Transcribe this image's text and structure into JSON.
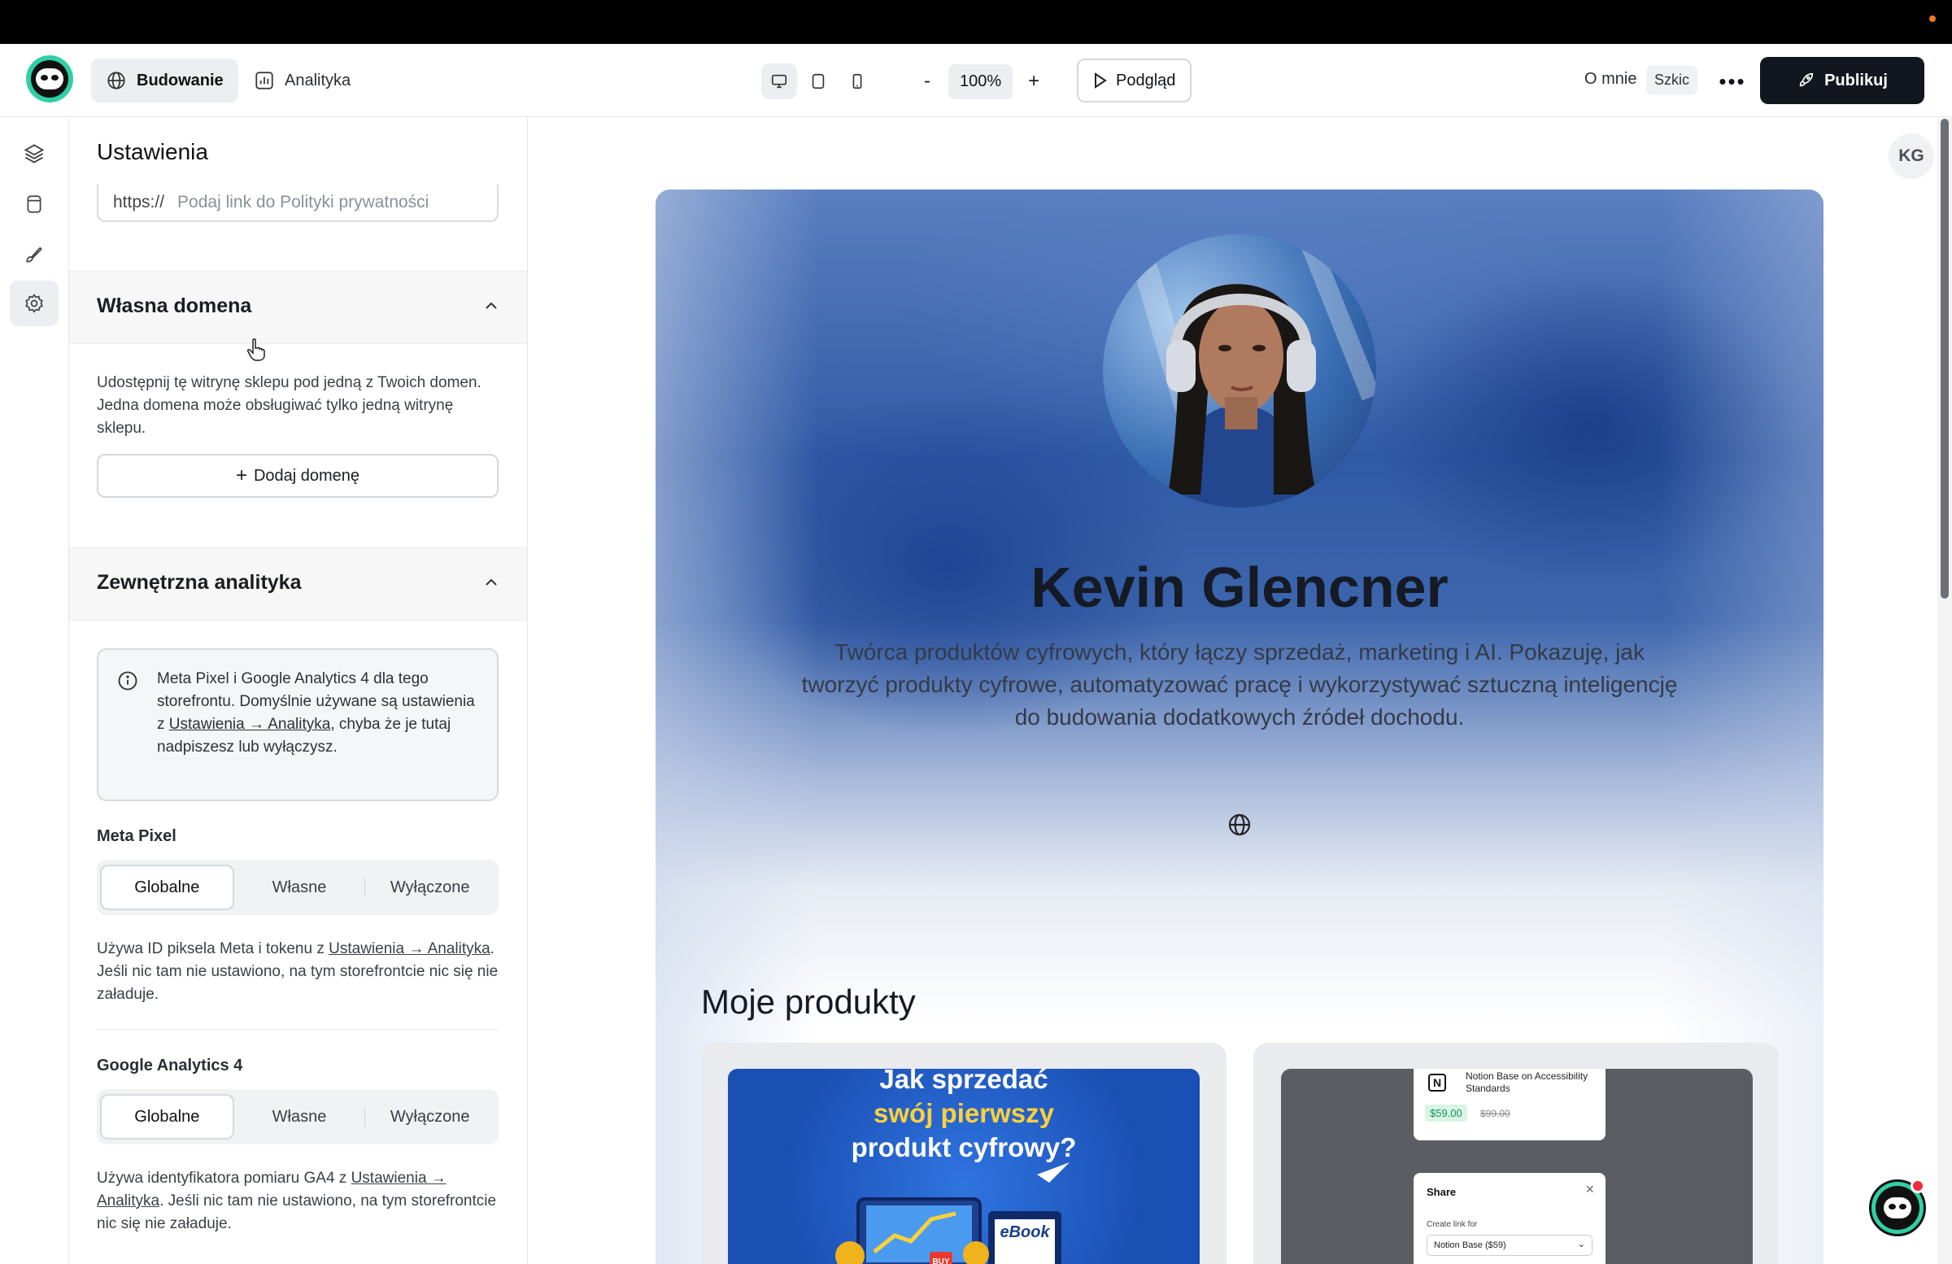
{
  "header": {
    "tabs": [
      {
        "label": "Budowanie",
        "icon": "globe-icon",
        "active": true
      },
      {
        "label": "Analityka",
        "icon": "bar-chart-icon",
        "active": false
      }
    ],
    "zoom": {
      "minus": "-",
      "value": "100%",
      "plus": "+"
    },
    "preview_label": "Podgląd",
    "page_name": "O mnie",
    "status_badge": "Szkic",
    "more_label": "•••",
    "publish_label": "Publikuj"
  },
  "rail": {
    "items": [
      {
        "icon": "layers-icon",
        "active": false
      },
      {
        "icon": "database-icon",
        "active": false
      },
      {
        "icon": "brush-icon",
        "active": false
      },
      {
        "icon": "gear-icon",
        "active": true
      }
    ]
  },
  "settings": {
    "title": "Ustawienia",
    "privacy_field": {
      "prefix": "https://",
      "placeholder": "Podaj link do Polityki prywatności"
    },
    "custom_domain": {
      "title": "Własna domena",
      "description": "Udostępnij tę witrynę sklepu pod jedną z Twoich domen. Jedna domena może obsługiwać tylko jedną witrynę sklepu.",
      "add_button": "Dodaj domenę"
    },
    "external_analytics": {
      "title": "Zewnętrzna analityka",
      "info_before": "Meta Pixel i Google Analytics 4 dla tego storefrontu. Domyślnie używane są ustawienia z ",
      "info_link": "Ustawienia → Analityka",
      "info_after": ", chyba że je tutaj nadpiszesz lub wyłączysz.",
      "meta_pixel": {
        "label": "Meta Pixel",
        "options": [
          "Globalne",
          "Własne",
          "Wyłączone"
        ],
        "selected": "Globalne",
        "help_before": "Używa ID piksela Meta i tokenu z ",
        "help_link": "Ustawienia → Analityka",
        "help_after": ". Jeśli nic tam nie ustawiono, na tym storefrontcie nic się nie załaduje."
      },
      "ga4": {
        "label": "Google Analytics 4",
        "options": [
          "Globalne",
          "Własne",
          "Wyłączone"
        ],
        "selected": "Globalne",
        "help_before": "Używa identyfikatora pomiaru GA4 z ",
        "help_link": "Ustawienia → Analityka",
        "help_after": ". Jeśli nic tam nie ustawiono, na tym storefrontcie nic się nie załaduje."
      }
    }
  },
  "canvas": {
    "user_initials": "KG",
    "profile": {
      "name": "Kevin Glencner",
      "bio": "Twórca produktów cyfrowych, który łączy sprzedaż, marketing i AI. Pokazuję, jak tworzyć produkty cyfrowe, automatyzować pracę i wykorzystywać sztuczną inteligencję do budowania dodatkowych źródeł dochodu."
    },
    "products_heading": "Moje produkty",
    "products": [
      {
        "title_line1": "Jak sprzedać",
        "title_line2": "swój pierwszy",
        "title_line3": "produkt cyfrowy?",
        "badge": "eBook",
        "buy": "BUY"
      },
      {
        "notion_title": "Notion Base on Accessibility Standards",
        "price": "$59.00",
        "old_price": "$99.00",
        "share_title": "Share",
        "share_sub": "Create link for",
        "share_select": "Notion Base ($59)"
      }
    ]
  }
}
